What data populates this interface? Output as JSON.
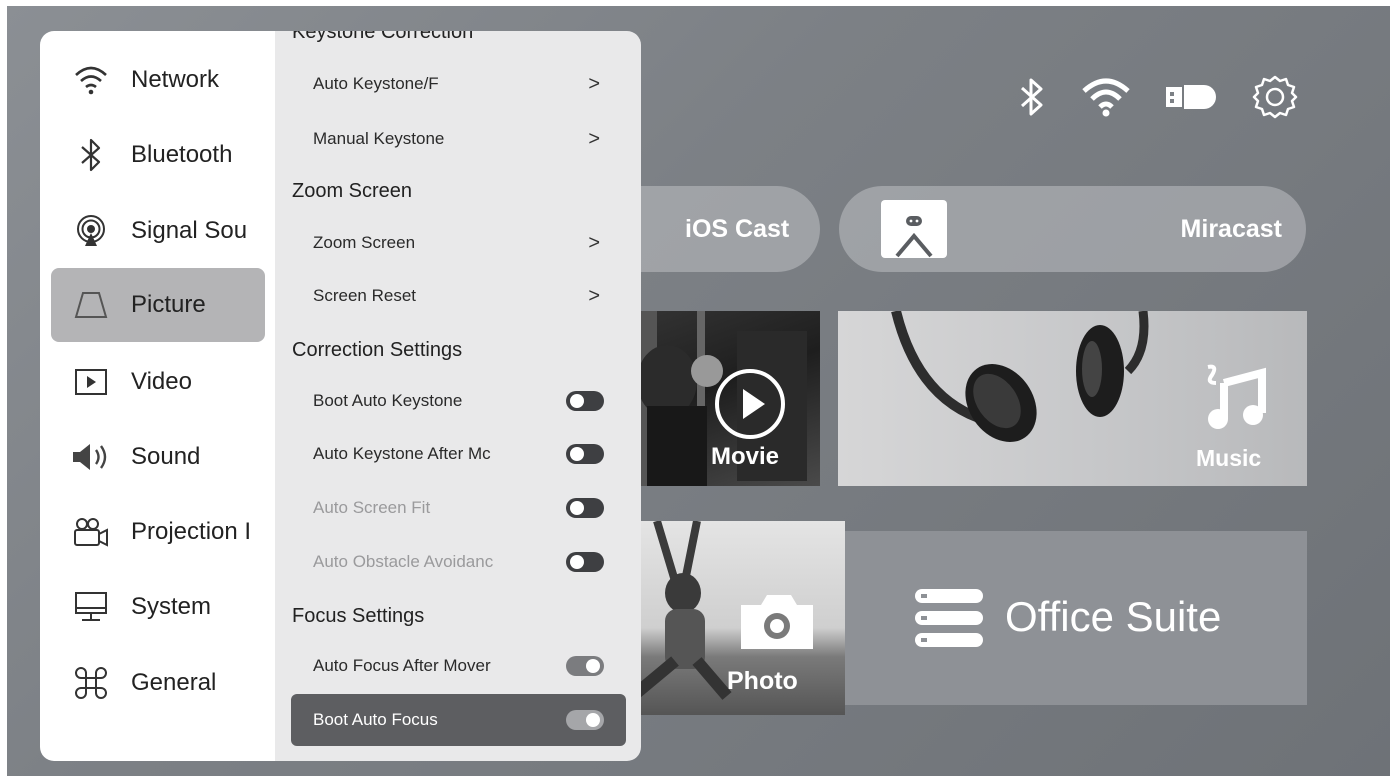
{
  "status_icons": [
    "bluetooth-icon",
    "wifi-icon",
    "usb-drive-icon",
    "settings-gear-icon"
  ],
  "cast": {
    "ios_label": "iOS Cast",
    "miracast_label": "Miracast"
  },
  "tiles": {
    "movie_label": "Movie",
    "music_label": "Music",
    "photo_label": "Photo",
    "office_label": "Office Suite"
  },
  "sidebar": {
    "items": [
      {
        "label": "Network",
        "icon": "wifi-icon"
      },
      {
        "label": "Bluetooth",
        "icon": "bluetooth-icon"
      },
      {
        "label": "Signal Sou",
        "icon": "signal-source-icon"
      },
      {
        "label": "Picture",
        "icon": "picture-trapezoid-icon",
        "active": true
      },
      {
        "label": "Video",
        "icon": "video-play-icon"
      },
      {
        "label": "Sound",
        "icon": "speaker-icon"
      },
      {
        "label": "Projection I",
        "icon": "projector-icon"
      },
      {
        "label": "System",
        "icon": "monitor-icon"
      },
      {
        "label": "General",
        "icon": "command-icon"
      }
    ]
  },
  "submenu": {
    "keystone_header": "Keystone Correction",
    "auto_keystone": "Auto Keystone/F",
    "manual_keystone": "Manual Keystone",
    "zoom_header": "Zoom Screen",
    "zoom_screen": "Zoom Screen",
    "screen_reset": "Screen Reset",
    "correction_header": "Correction Settings",
    "boot_auto_keystone": "Boot Auto Keystone",
    "auto_keystone_after": "Auto Keystone After Mc",
    "auto_screen_fit": "Auto Screen Fit",
    "auto_obstacle": "Auto Obstacle Avoidanc",
    "focus_header": "Focus Settings",
    "auto_focus_after": "Auto Focus After Mover",
    "boot_auto_focus": "Boot Auto Focus",
    "toggles": {
      "boot_auto_keystone": false,
      "auto_keystone_after": false,
      "auto_screen_fit": false,
      "auto_obstacle": false,
      "auto_focus_after": true,
      "boot_auto_focus": true
    }
  }
}
